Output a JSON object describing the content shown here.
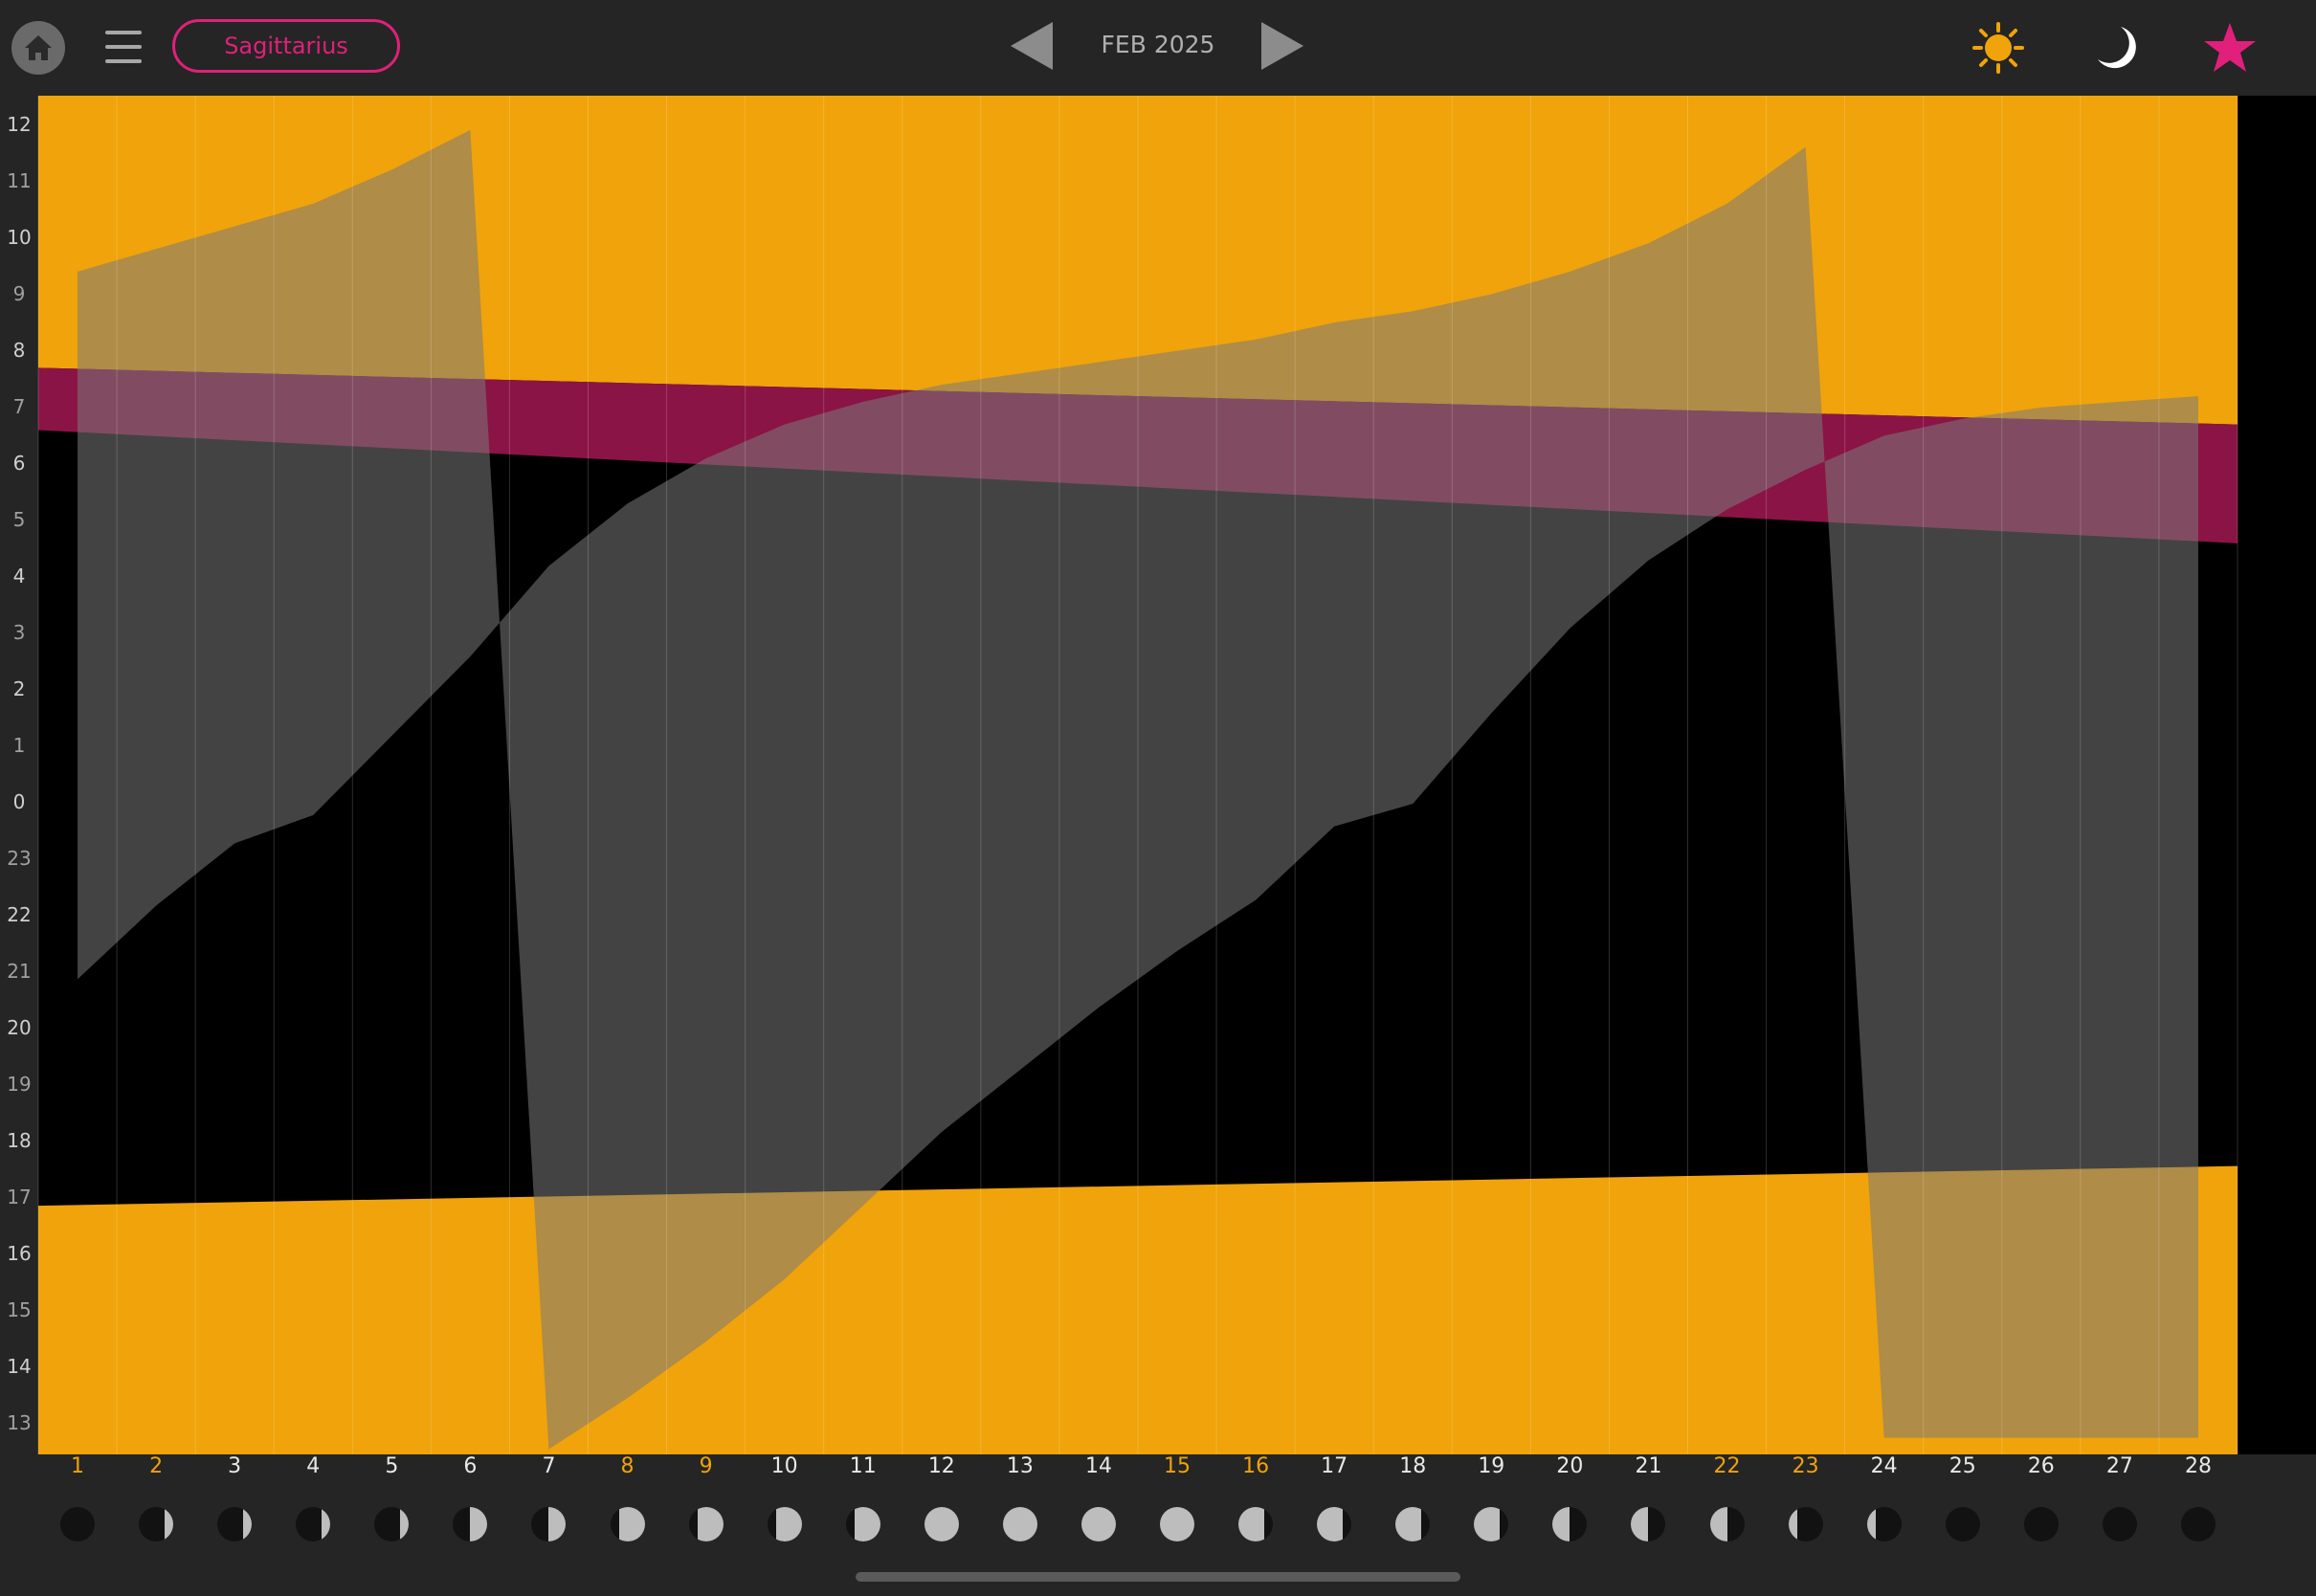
{
  "header": {
    "target_name": "Sagittarius",
    "month_label": "FEB 2025",
    "icons": [
      "home-icon",
      "menu-icon",
      "prev-arrow-icon",
      "next-arrow-icon",
      "sun-icon",
      "moon-icon",
      "star-icon"
    ]
  },
  "colors": {
    "background": "#252525",
    "sun": "#f0a30a",
    "target_accent": "#e0207a",
    "twilight_band": "#8a1446",
    "moon_overlay": "#7a7a7a",
    "weekend_label": "#f0a30a",
    "weekday_label": "#e8e8e8"
  },
  "chart_data": {
    "type": "area",
    "title": "",
    "hour_ticks": [
      "12",
      "11",
      "10",
      "9",
      "8",
      "7",
      "6",
      "5",
      "4",
      "3",
      "2",
      "1",
      "0",
      "23",
      "22",
      "21",
      "20",
      "19",
      "18",
      "17",
      "16",
      "15",
      "14",
      "13"
    ],
    "days": [
      1,
      2,
      3,
      4,
      5,
      6,
      7,
      8,
      9,
      10,
      11,
      12,
      13,
      14,
      15,
      16,
      17,
      18,
      19,
      20,
      21,
      22,
      23,
      24,
      25,
      26,
      27,
      28
    ],
    "highlighted_days": [
      1,
      2,
      8,
      9,
      15,
      16,
      22,
      23
    ],
    "series": [
      {
        "name": "sun",
        "evening_start": 16.9,
        "evening_end": 17.6,
        "morning_end_start": 7.7,
        "morning_end_end": 6.7
      },
      {
        "name": "twilight",
        "dawn_start_begin": 6.6,
        "dawn_start_end": 4.6
      },
      {
        "name": "moon",
        "rise": [
          20.9,
          22.2,
          23.3,
          23.8,
          1.2,
          2.6,
          4.2,
          5.3,
          6.1,
          6.7,
          7.1,
          7.4,
          7.6,
          7.8,
          8.0,
          8.2,
          8.5,
          8.7,
          9.0,
          9.4,
          9.9,
          10.6,
          11.6,
          12.8,
          12.8,
          12.8,
          12.8,
          12.8
        ],
        "set": [
          9.4,
          9.8,
          10.2,
          10.6,
          11.2,
          11.9,
          12.6,
          13.5,
          14.5,
          15.6,
          16.9,
          18.2,
          19.3,
          20.4,
          21.4,
          22.3,
          23.6,
          0.0,
          1.6,
          3.1,
          4.3,
          5.2,
          5.9,
          6.5,
          6.8,
          7.0,
          7.1,
          7.2
        ]
      }
    ],
    "moon_phases": [
      "new",
      "waxing-crescent",
      "waxing-crescent",
      "waxing-crescent",
      "waxing-crescent",
      "first-quarter",
      "first-quarter",
      "waxing-gibbous",
      "waxing-gibbous",
      "waxing-gibbous",
      "waxing-gibbous",
      "full",
      "full",
      "full",
      "full",
      "waning-gibbous",
      "waning-gibbous",
      "waning-gibbous",
      "waning-gibbous",
      "last-quarter",
      "last-quarter",
      "last-quarter",
      "waning-crescent",
      "waning-crescent",
      "new",
      "new",
      "new",
      "new"
    ],
    "grid": true
  }
}
